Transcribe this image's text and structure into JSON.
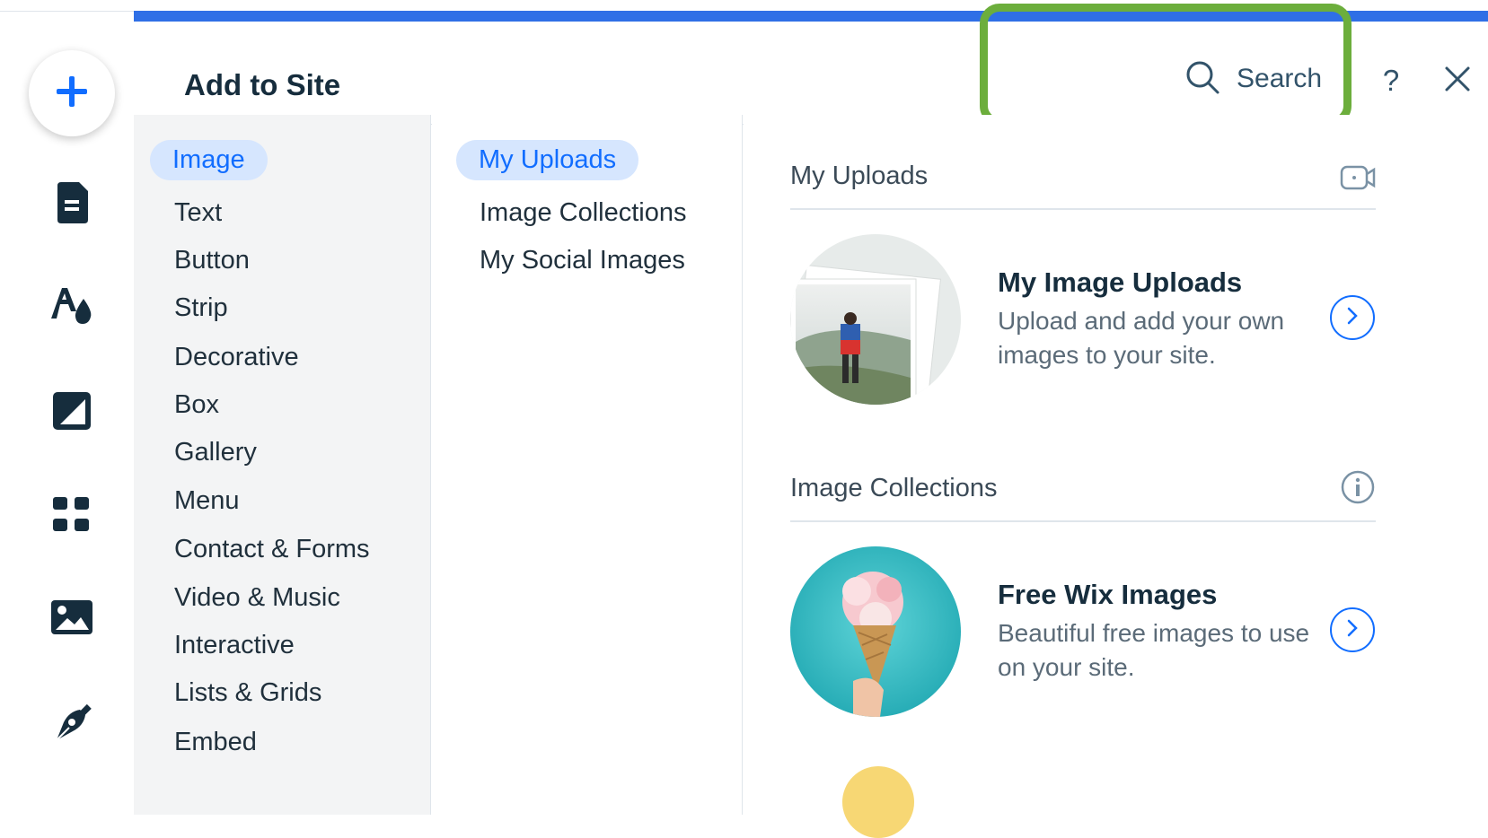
{
  "left_rail": {
    "icons": [
      "plus-icon",
      "page-icon",
      "theme-icon",
      "background-icon",
      "apps-icon",
      "media-icon",
      "pen-icon"
    ]
  },
  "panel": {
    "title": "Add to Site",
    "search_label": "Search",
    "help_label": "?"
  },
  "categories": {
    "items": [
      "Image",
      "Text",
      "Button",
      "Strip",
      "Decorative",
      "Box",
      "Gallery",
      "Menu",
      "Contact & Forms",
      "Video & Music",
      "Interactive",
      "Lists & Grids",
      "Embed"
    ],
    "selected": "Image"
  },
  "subcategories": {
    "items": [
      "My Uploads",
      "Image Collections",
      "My Social Images"
    ],
    "selected": "My Uploads"
  },
  "main": {
    "uploads_section": {
      "title": "My Uploads",
      "card": {
        "title": "My Image Uploads",
        "description": "Upload and add your own images to your site."
      }
    },
    "collections_section": {
      "title": "Image Collections",
      "card": {
        "title": "Free Wix Images",
        "description": "Beautiful free images to use on your site."
      }
    }
  },
  "colors": {
    "accent": "#116dff",
    "topbar": "#2f6fe6",
    "highlight": "#6cae3c",
    "selected_bg": "#d6e6fe"
  }
}
